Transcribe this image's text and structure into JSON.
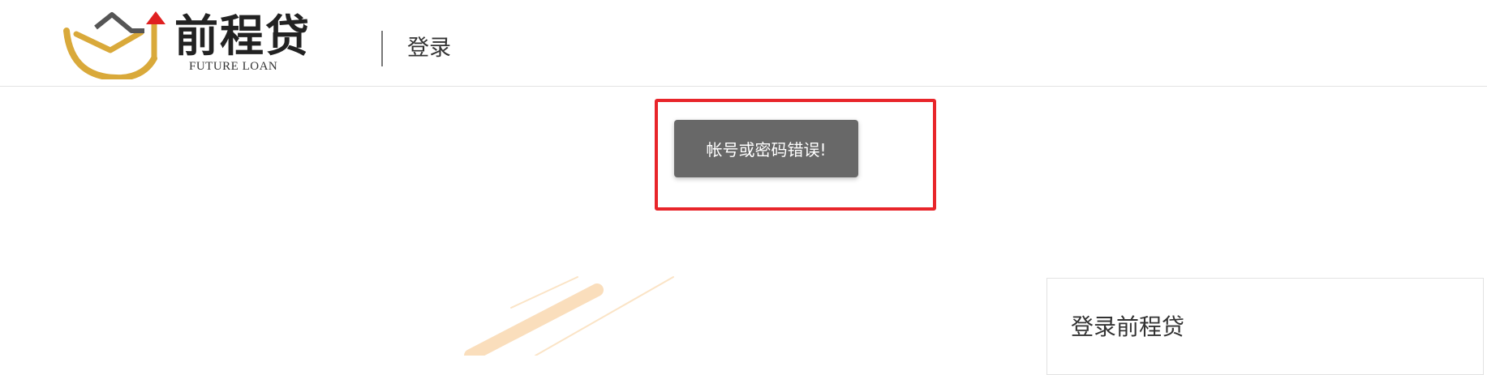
{
  "header": {
    "logo_title": "前程贷",
    "logo_subtitle": "FUTURE LOAN",
    "page_title": "登录"
  },
  "toast": {
    "message": "帐号或密码错误!"
  },
  "login_card": {
    "title": "登录前程贷"
  },
  "colors": {
    "logo_gold": "#d9a93a",
    "logo_arrow": "#e02020",
    "highlight_red": "#e8252a",
    "toast_bg": "#686868",
    "decor_orange": "#f7c48a"
  },
  "icons": {
    "logo_mark": "house-bowl-arrow-logo"
  }
}
